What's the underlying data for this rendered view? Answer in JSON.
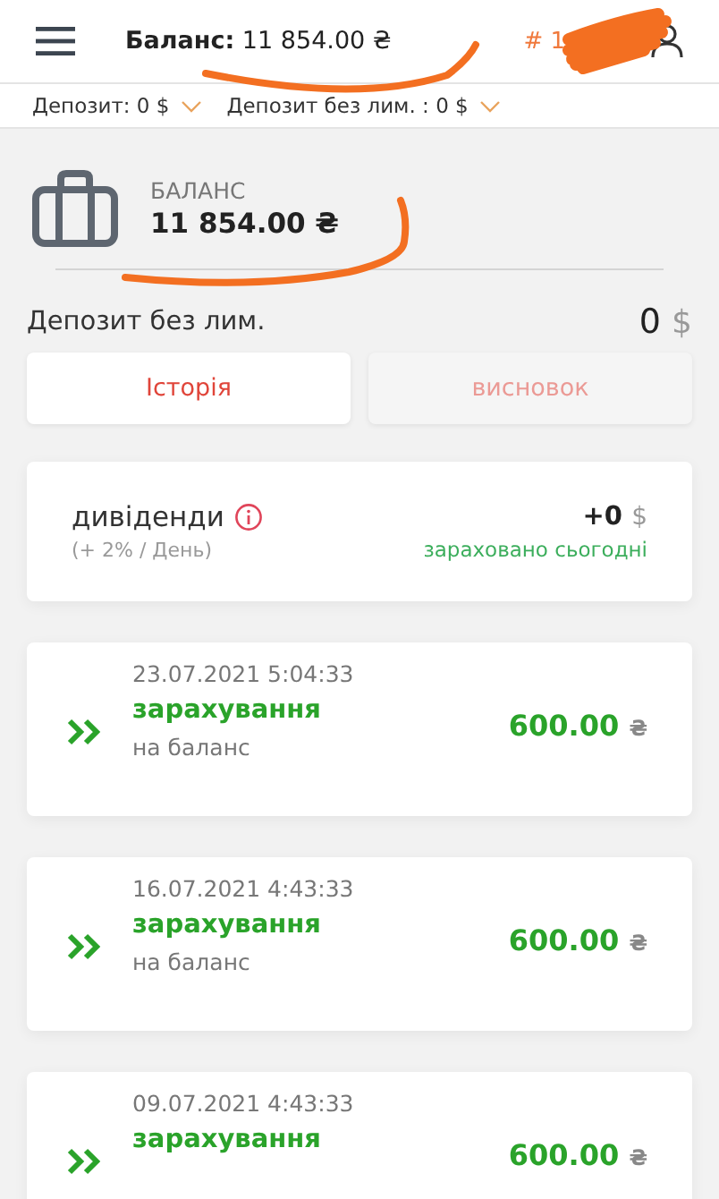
{
  "header": {
    "balance_label": "Баланс:",
    "balance_value": "11 854.00 ₴",
    "account_id": "# 1"
  },
  "deposits": [
    {
      "label": "Депозит: 0 $"
    },
    {
      "label": "Депозит без лим. : 0 $"
    }
  ],
  "balance": {
    "label": "БАЛАНС",
    "value": "11 854.00 ₴"
  },
  "unlimited_deposit": {
    "label": "Депозит без лим.",
    "amount": "0",
    "currency": "$"
  },
  "buttons": [
    {
      "label": "Історія",
      "disabled": false
    },
    {
      "label": "висновок",
      "disabled": true
    }
  ],
  "dividends": {
    "title": "дивіденди",
    "rate": "(+ 2% / День)",
    "amount": "+0",
    "currency": "$",
    "status": "зараховано сьогодні"
  },
  "transactions": [
    {
      "date": "23.07.2021 5:04:33",
      "type": "зарахування",
      "amount": "600.00",
      "currency": "₴",
      "note": "на баланс"
    },
    {
      "date": "16.07.2021 4:43:33",
      "type": "зарахування",
      "amount": "600.00",
      "currency": "₴",
      "note": "на баланс"
    },
    {
      "date": "09.07.2021 4:43:33",
      "type": "зарахування",
      "amount": "600.00",
      "currency": "₴"
    }
  ]
}
